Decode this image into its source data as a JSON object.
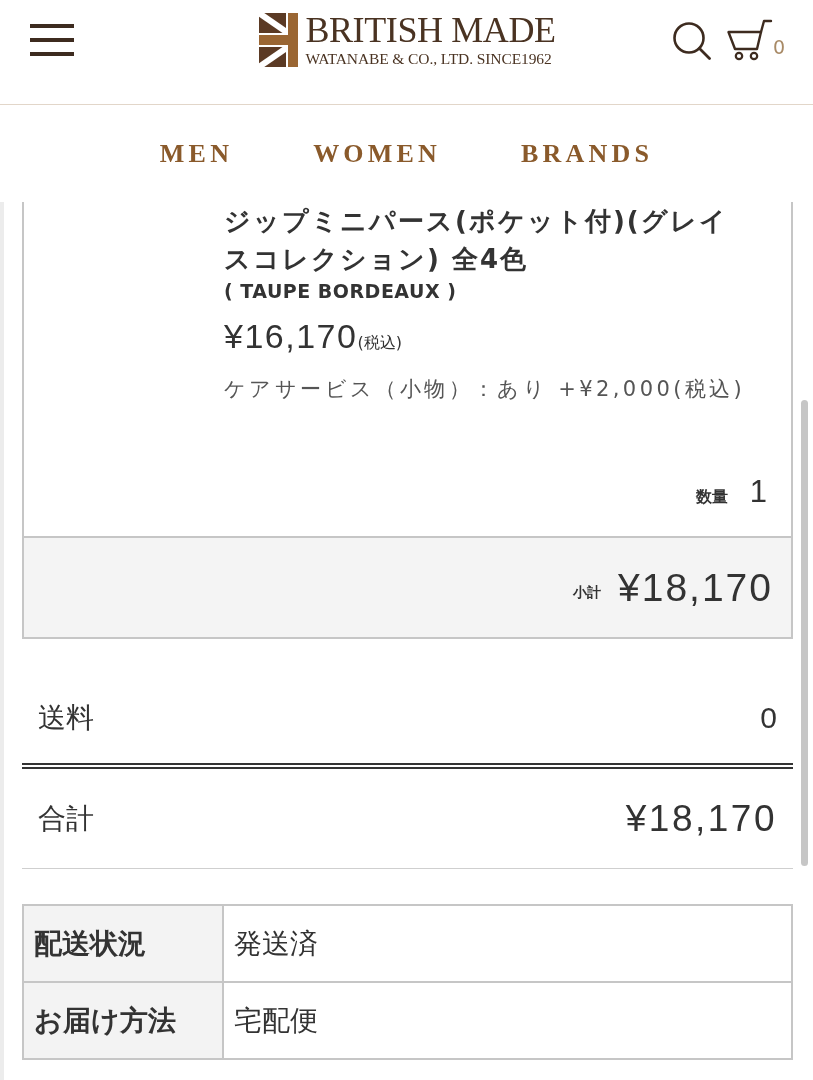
{
  "header": {
    "brand": "BRITISH MADE",
    "tagline": "WATANABE & CO., LTD. SINCE1962",
    "cart_count": "0"
  },
  "nav": [
    "MEN",
    "WOMEN",
    "BRANDS"
  ],
  "order_item": {
    "name": "ジップミニパース(ポケット付)(グレイスコレクション) 全4色",
    "variant": "( TAUPE BORDEAUX )",
    "price": "¥16,170",
    "price_note": "(税込)",
    "option": "ケアサービス（小物）：あり +¥2,000(税込)",
    "quantity_label": "数量",
    "quantity": "1",
    "subtotal_label": "小計",
    "subtotal": "¥18,170"
  },
  "summary": [
    {
      "kind": "shipping",
      "label": "送料",
      "value": "0"
    },
    {
      "kind": "total",
      "label": "合計",
      "value": "¥18,170"
    }
  ],
  "details": [
    {
      "label": "配送状況",
      "value": "発送済"
    },
    {
      "label": "お届け方法",
      "value": "宅配便"
    }
  ]
}
